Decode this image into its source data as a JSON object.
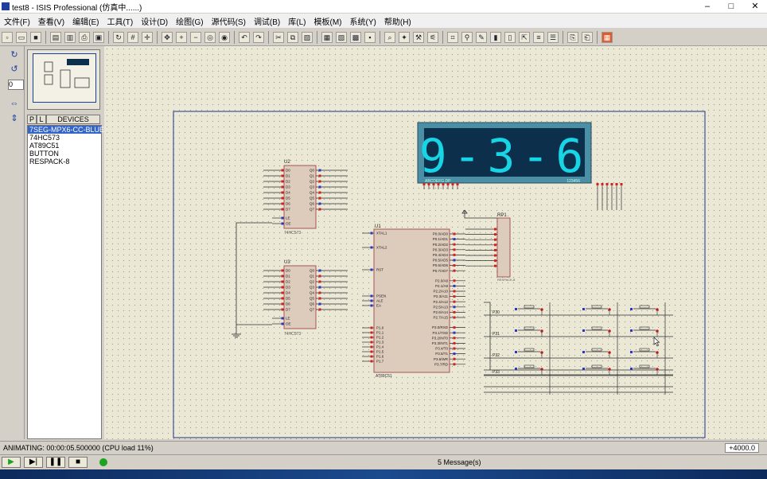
{
  "window": {
    "title": "test8 - ISIS Professional (仿真中......)"
  },
  "menu": [
    "文件(F)",
    "查看(V)",
    "编辑(E)",
    "工具(T)",
    "设计(D)",
    "绘图(G)",
    "源代码(S)",
    "调试(B)",
    "库(L)",
    "模板(M)",
    "系统(Y)",
    "帮助(H)"
  ],
  "left_toolbar": {
    "rotation_value": "0"
  },
  "panel": {
    "tab_p": "P",
    "tab_l": "L",
    "header": "DEVICES",
    "devices": [
      "7SEG-MPX6-CC-BLUE",
      "74HC573",
      "AT89C51",
      "BUTTON",
      "RESPACK-8"
    ],
    "selected_index": 0
  },
  "schematic": {
    "display_text": "9-3-6",
    "display_label_left": "ABCDEFG DP",
    "display_label_right": "123456",
    "refs": {
      "u2": "U2",
      "u3": "U3",
      "u1": "U1",
      "rp1": "RP1"
    },
    "chip_names": {
      "u2": "74HC573",
      "u3": "74HC573",
      "u1": "AT89C51",
      "rp1": "RESPACK-8"
    },
    "u1_left_pins": [
      "XTAL1",
      "XTAL2",
      "RST",
      "PSEN",
      "ALE",
      "EA",
      "P1.0",
      "P1.1",
      "P1.2",
      "P1.3",
      "P1.4",
      "P1.5",
      "P1.6",
      "P1.7"
    ],
    "u1_right_pins": [
      "P0.0/AD0",
      "P0.1/AD1",
      "P0.2/AD2",
      "P0.3/AD3",
      "P0.4/AD4",
      "P0.5/AD5",
      "P0.6/AD6",
      "P0.7/AD7",
      "P2.0/A8",
      "P2.1/A9",
      "P2.2/A10",
      "P2.3/A11",
      "P2.4/A12",
      "P2.5/A13",
      "P2.6/A14",
      "P2.7/A15",
      "P3.0/RXD",
      "P3.1/TXD",
      "P3.2/INT0",
      "P3.3/INT1",
      "P3.4/T0",
      "P3.5/T1",
      "P3.6/WR",
      "P3.7/RD"
    ],
    "latch_inputs": [
      "D0",
      "D1",
      "D2",
      "D3",
      "D4",
      "D5",
      "D6",
      "D7"
    ],
    "latch_outputs": [
      "Q0",
      "Q1",
      "Q2",
      "Q3",
      "Q4",
      "Q5",
      "Q6",
      "Q7"
    ],
    "latch_controls": [
      "LE",
      "OE"
    ],
    "keypad_labels": [
      "P30",
      "P31",
      "P32",
      "P33"
    ]
  },
  "status": {
    "text": "ANIMATING: 00:00:05.500000 (CPU load 11%)",
    "coord": "+4000.0"
  },
  "sim": {
    "messages": "5 Message(s)"
  },
  "colors": {
    "segment": "#18d5e6",
    "display_bg": "#0c2f4c",
    "display_frame": "#4a8fa6",
    "chip_fill": "#ddcbbc",
    "chip_border": "#a55555",
    "wire": "#2f2f2f",
    "red_pin": "#d62020",
    "blue_pin": "#2e35c6"
  }
}
